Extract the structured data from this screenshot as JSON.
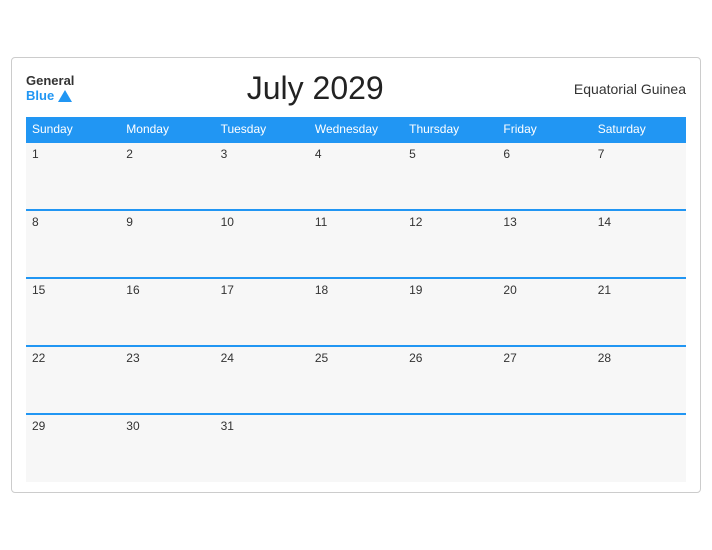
{
  "header": {
    "logo_general": "General",
    "logo_blue": "Blue",
    "title": "July 2029",
    "region": "Equatorial Guinea"
  },
  "weekdays": [
    "Sunday",
    "Monday",
    "Tuesday",
    "Wednesday",
    "Thursday",
    "Friday",
    "Saturday"
  ],
  "weeks": [
    [
      1,
      2,
      3,
      4,
      5,
      6,
      7
    ],
    [
      8,
      9,
      10,
      11,
      12,
      13,
      14
    ],
    [
      15,
      16,
      17,
      18,
      19,
      20,
      21
    ],
    [
      22,
      23,
      24,
      25,
      26,
      27,
      28
    ],
    [
      29,
      30,
      31,
      null,
      null,
      null,
      null
    ]
  ]
}
